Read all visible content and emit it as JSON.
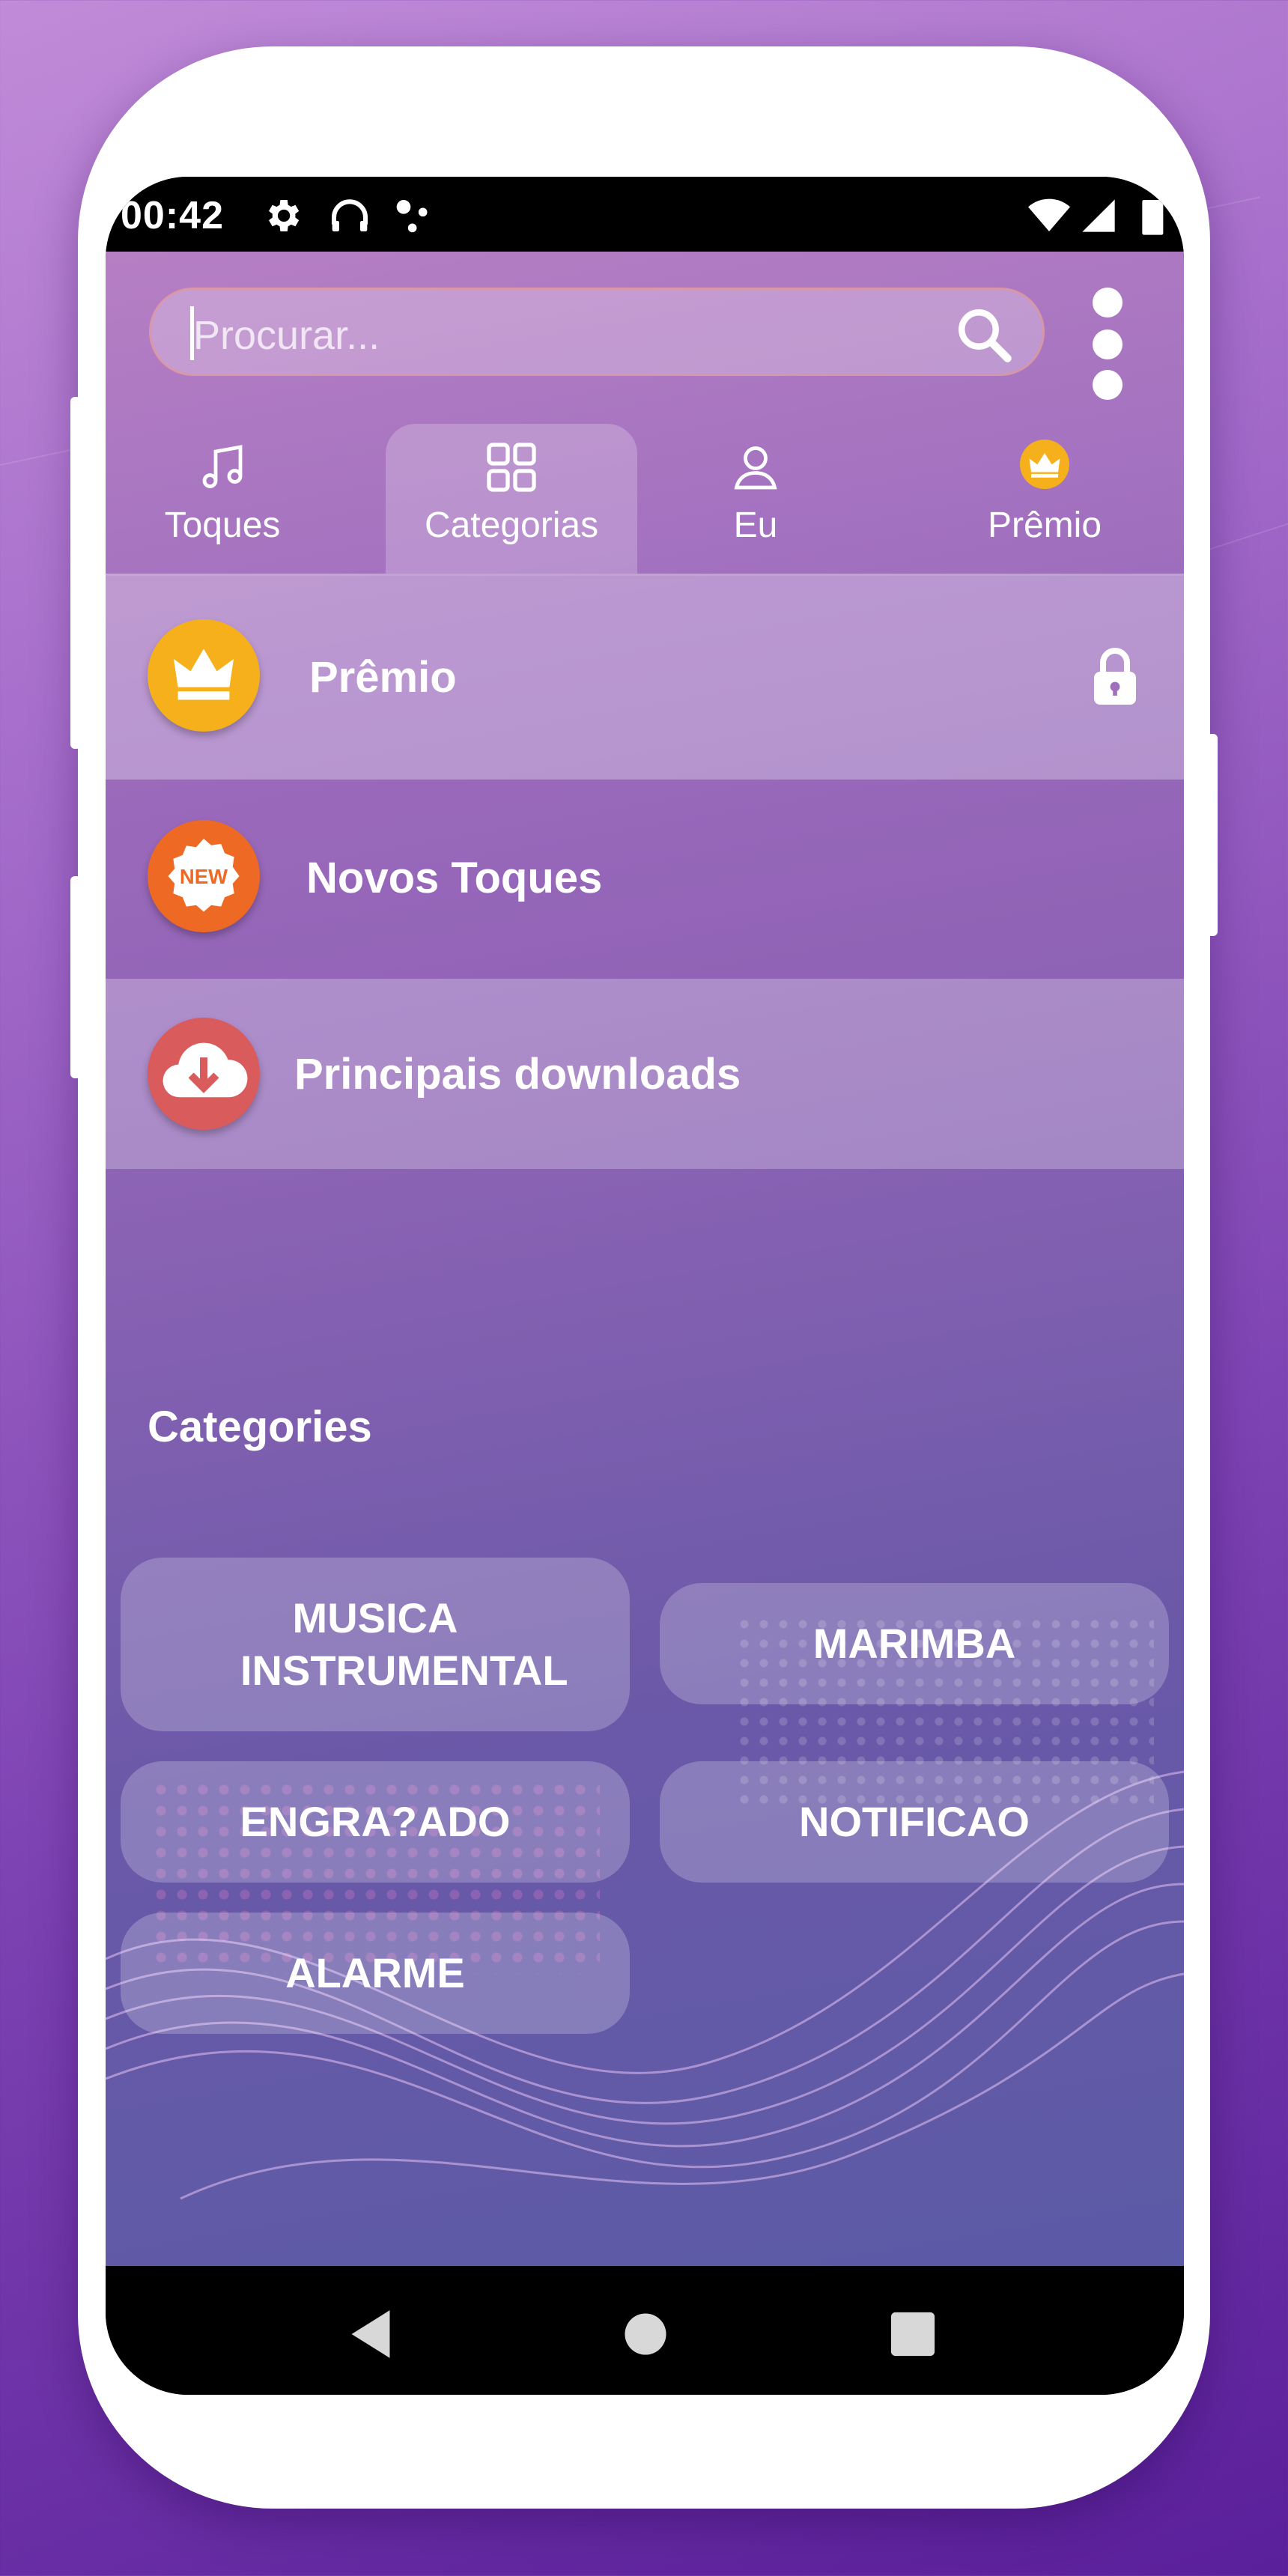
{
  "status_bar": {
    "time": "00:42",
    "icons": [
      "gear-icon",
      "headphones-icon",
      "notification-dots-icon",
      "wifi-icon",
      "signal-icon",
      "battery-icon"
    ]
  },
  "search": {
    "placeholder": "Procurar...",
    "icon": "search-icon"
  },
  "menu": {
    "icon": "more-vert-icon"
  },
  "tabs": [
    {
      "label": "Toques",
      "icon": "music-note-icon",
      "active": false
    },
    {
      "label": "Categorias",
      "icon": "grid-icon",
      "active": true
    },
    {
      "label": "Eu",
      "icon": "person-icon",
      "active": false
    },
    {
      "label": "Prêmio",
      "icon": "crown-icon",
      "active": false
    }
  ],
  "featured": [
    {
      "label": "Prêmio",
      "icon": "crown-icon",
      "icon_color": "#f5b01c",
      "locked": true
    },
    {
      "label": "Novos Toques",
      "icon": "new-badge-icon",
      "badge_text": "NEW",
      "icon_color": "#ee6a24"
    },
    {
      "label": "Principais downloads",
      "icon": "cloud-download-icon",
      "icon_color": "#d95b5b"
    }
  ],
  "categories_section": {
    "title": "Categories",
    "items": [
      "MUSICA INSTRUMENTAL",
      "MARIMBA",
      "ENGRA?ADO",
      "NOTIFICAO",
      "ALARME"
    ]
  },
  "nav_bar": [
    "back-icon",
    "home-icon",
    "recents-icon"
  ],
  "colors": {
    "background_top": "#c18bd8",
    "background_bottom": "#5a1f9a",
    "accent_gold": "#f5b01c",
    "accent_orange": "#ee6a24",
    "accent_red": "#d95b5b"
  }
}
